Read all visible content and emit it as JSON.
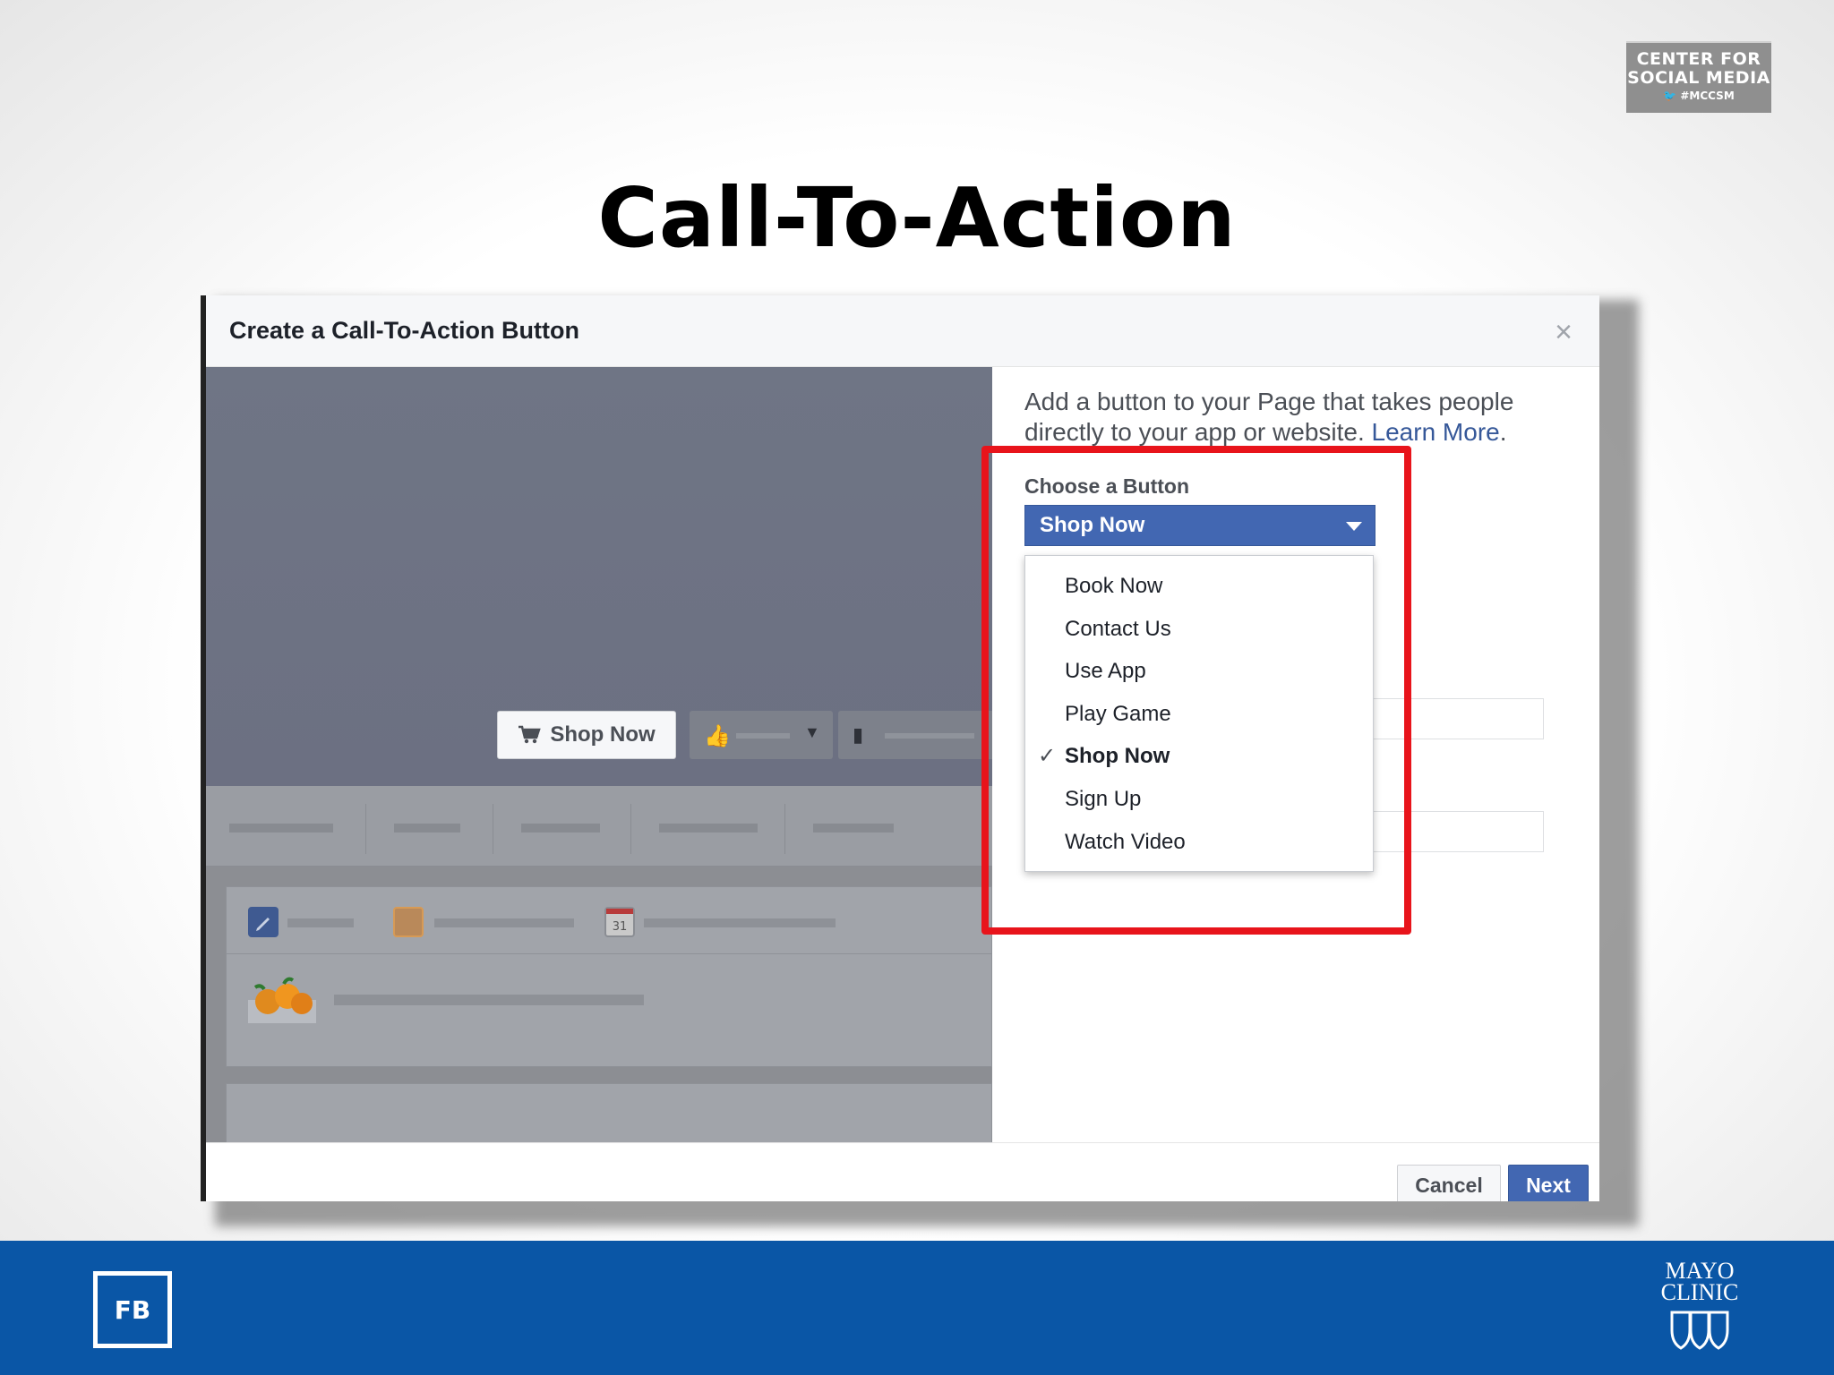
{
  "slide": {
    "title": "Call-To-Action",
    "badge": {
      "line1": "CENTER FOR",
      "line2": "SOCIAL MEDIA",
      "line3": "🐦 #MCCSM"
    },
    "footer": {
      "fb_label": "FB",
      "logo_line1": "MAYO",
      "logo_line2": "CLINIC"
    }
  },
  "dialog": {
    "title": "Create a Call-To-Action Button",
    "close_icon": "×",
    "preview": {
      "cta_label": "Shop Now",
      "cta_icon": "cart-icon"
    },
    "description": "Add a button to your Page that takes people directly to your app or website.",
    "learn_more": "Learn More",
    "description_end": ".",
    "choose_label": "Choose a Button",
    "selected_value": "Shop Now",
    "options": [
      {
        "label": "Book Now",
        "selected": false
      },
      {
        "label": "Contact Us",
        "selected": false
      },
      {
        "label": "Use App",
        "selected": false
      },
      {
        "label": "Play Game",
        "selected": false
      },
      {
        "label": "Shop Now",
        "selected": true
      },
      {
        "label": "Sign Up",
        "selected": false
      },
      {
        "label": "Watch Video",
        "selected": false
      }
    ],
    "check_glyph": "✓",
    "cancel_label": "Cancel",
    "next_label": "Next"
  },
  "colors": {
    "facebook_blue": "#4267b2",
    "highlight_red": "#e8141b",
    "banner_blue": "#0a56a6"
  }
}
